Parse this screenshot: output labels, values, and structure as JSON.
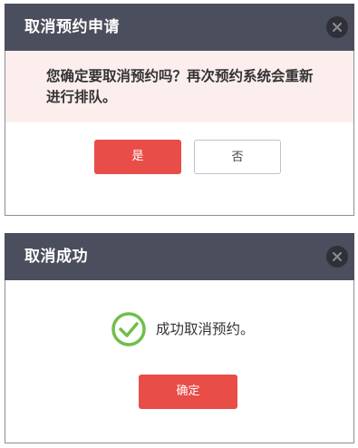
{
  "cancel_dialog": {
    "title": "取消预约申请",
    "message_line1": "您确定要取消预约吗？再次预约系统会重新",
    "message_line2": "进行排队。",
    "yes_label": "是",
    "no_label": "否",
    "close_icon": "close-icon"
  },
  "success_dialog": {
    "title": "取消成功",
    "message": "成功取消预约。",
    "status_icon": "check-circle-icon",
    "ok_label": "确定",
    "close_icon": "close-icon"
  },
  "colors": {
    "titlebar": "#4b4e5c",
    "close_button": "#2f3038",
    "primary_button": "#e84d48",
    "warning_background": "#fdeeee",
    "success_green": "#6fbf4a",
    "default_button_border": "#b9c4cf"
  }
}
